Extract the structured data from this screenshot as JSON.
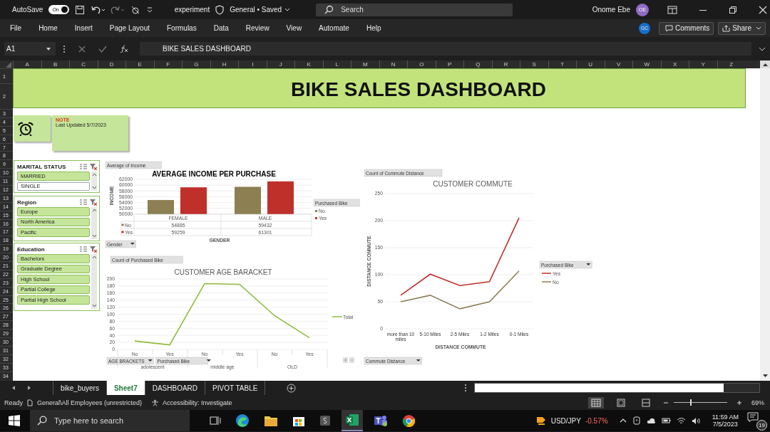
{
  "titlebar": {
    "autosave_label": "AutoSave",
    "autosave_toggle": "On",
    "autosave_on": true,
    "file_name": "experiment",
    "status": "General • Saved",
    "search_placeholder": "Search",
    "user_name": "Onome Ebe",
    "user_initials": "OE"
  },
  "menu": [
    "File",
    "Home",
    "Insert",
    "Page Layout",
    "Formulas",
    "Data",
    "Review",
    "View",
    "Automate",
    "Help"
  ],
  "collaborator_initials": "GC",
  "comments_button": "Comments",
  "share_button": "Share",
  "formula_bar": {
    "name_box": "A1",
    "content": "BIKE SALES DASHBOARD"
  },
  "columns": [
    "A",
    "B",
    "C",
    "D",
    "E",
    "F",
    "G",
    "H",
    "I",
    "J",
    "K",
    "L",
    "M",
    "N",
    "O",
    "P",
    "Q",
    "R",
    "S",
    "T",
    "U",
    "V",
    "W",
    "X",
    "Y",
    "Z"
  ],
  "rows": [
    "1",
    "2",
    "3",
    "4",
    "5",
    "6",
    "7",
    "8",
    "9",
    "10",
    "11",
    "12",
    "13",
    "14",
    "15",
    "16",
    "17",
    "18",
    "19",
    "20",
    "21",
    "22",
    "23",
    "24",
    "25",
    "26",
    "27",
    "28",
    "29",
    "30",
    "31",
    "32",
    "33",
    "34"
  ],
  "banner": "BIKE SALES DASHBOARD",
  "note": {
    "heading": "NOTE",
    "text": "Last Updated 5/7/2023"
  },
  "slicers": [
    {
      "title": "MARITAL STATUS",
      "items": [
        {
          "label": "MARRIED",
          "selected": true
        },
        {
          "label": "SINGLE",
          "selected": false
        }
      ]
    },
    {
      "title": "Region",
      "items": [
        {
          "label": "Europe",
          "selected": true
        },
        {
          "label": "North America",
          "selected": true
        },
        {
          "label": "Pacific",
          "selected": true
        }
      ]
    },
    {
      "title": "Education",
      "items": [
        {
          "label": "Bachelors",
          "selected": true
        },
        {
          "label": "Graduate Degree",
          "selected": true
        },
        {
          "label": "High School",
          "selected": true
        },
        {
          "label": "Partial College",
          "selected": true
        },
        {
          "label": "Partial High School",
          "selected": true
        }
      ]
    }
  ],
  "income_chart": {
    "value_button": "Average of Income",
    "legend_button": "Purchased Bike",
    "axis_button": "Gender",
    "table_rows": [
      {
        "label": "No",
        "values": [
          "54885",
          "59432"
        ]
      },
      {
        "label": "Yes",
        "values": [
          "59259",
          "61301"
        ]
      }
    ],
    "chart_data": {
      "type": "bar",
      "title": "AVERAGE INCOME PER PURCHASE",
      "xlabel": "GENDER",
      "ylabel": "INCOME",
      "categories": [
        "FEMALE",
        "MALE"
      ],
      "series": [
        {
          "name": "No",
          "color": "#8c7f52",
          "values": [
            54885,
            59432
          ]
        },
        {
          "name": "Yes",
          "color": "#c0302a",
          "values": [
            59259,
            61301
          ]
        }
      ],
      "ylim": [
        50000,
        62000
      ],
      "yticks": [
        50000,
        52000,
        54000,
        56000,
        58000,
        60000,
        62000
      ],
      "grid": true,
      "legend": true
    }
  },
  "age_chart": {
    "value_button": "Count of Purchased Bike",
    "axis_buttons": [
      "AGE BRACKETS",
      "Purchased Bike"
    ],
    "group_labels": [
      "adolescent",
      "middle age",
      "OLD"
    ],
    "chart_data": {
      "type": "line",
      "title": "CUSTOMER AGE BARACKET",
      "categories": [
        "No",
        "Yes",
        "No",
        "Yes",
        "No",
        "Yes"
      ],
      "series": [
        {
          "name": "Total",
          "color": "#8dbb3c",
          "values": [
            24,
            13,
            187,
            185,
            96,
            33
          ]
        }
      ],
      "ylim": [
        0,
        200
      ],
      "yticks": [
        0,
        20,
        40,
        60,
        80,
        100,
        120,
        140,
        160,
        180,
        200
      ],
      "grid": true,
      "legend": true
    }
  },
  "commute_chart": {
    "value_button": "Count of Commute Distance",
    "legend_button": "Purchased Bike",
    "axis_button": "Commute Distance",
    "chart_data": {
      "type": "line",
      "title": "CUSTOMER COMMUTE",
      "xlabel": "DISTANCE COMMUTE",
      "ylabel": "DISTANCE COMMUTE",
      "categories": [
        "more than 10 miles",
        "5-10 Miles",
        "2-5 Miles",
        "1-2 Miles",
        "0-1 Miles"
      ],
      "series": [
        {
          "name": "Yes",
          "color": "#c0302a",
          "values": [
            62,
            101,
            80,
            87,
            205
          ]
        },
        {
          "name": "No",
          "color": "#8c7f52",
          "values": [
            50,
            62,
            37,
            50,
            107
          ]
        }
      ],
      "ylim": [
        0,
        250
      ],
      "yticks": [
        0,
        50,
        100,
        150,
        200,
        250
      ],
      "grid": true,
      "legend": true
    }
  },
  "sheet_tabs": [
    {
      "label": "bike_buyers",
      "selected": false
    },
    {
      "label": "Sheet7",
      "selected": true
    },
    {
      "label": "DASHBOARD",
      "selected": false
    },
    {
      "label": "PIVOT TABLE",
      "selected": false
    }
  ],
  "status_bar": {
    "ready": "Ready",
    "sensitivity": "General\\All Employees (unrestricted)",
    "accessibility": "Accessibility: Investigate",
    "zoom": "69%",
    "zoom_slider": {
      "level": 0.31
    }
  },
  "taskbar": {
    "search_placeholder": "Type here to search",
    "ticker": "USD/JPY",
    "ticker_change": "-0.57%",
    "time": "11:59 AM",
    "date": "7/5/2023",
    "notifications": "19"
  }
}
